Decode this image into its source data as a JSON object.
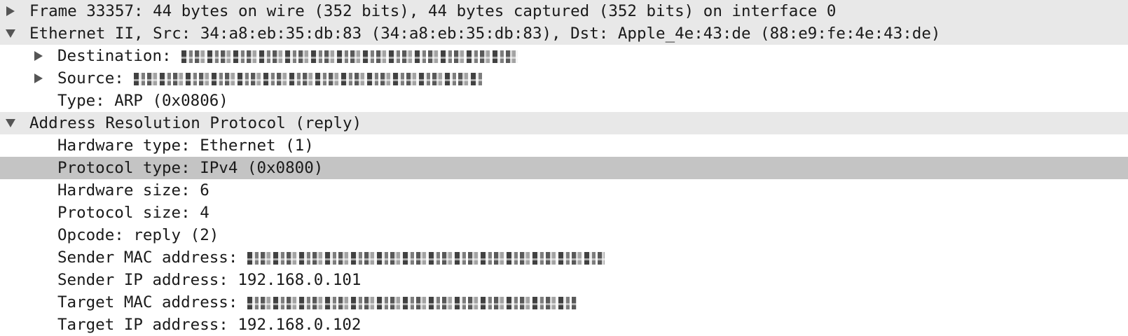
{
  "tree": {
    "frame": {
      "label": "Frame 33357: 44 bytes on wire (352 bits), 44 bytes captured (352 bits) on interface 0",
      "expanded": false
    },
    "ethernet": {
      "label": "Ethernet II, Src: 34:a8:eb:35:db:83 (34:a8:eb:35:db:83), Dst: Apple_4e:43:de (88:e9:fe:4e:43:de)",
      "expanded": true,
      "destination_label": "Destination:",
      "source_label": "Source:",
      "type_label": "Type: ARP (0x0806)"
    },
    "arp": {
      "label": "Address Resolution Protocol (reply)",
      "expanded": true,
      "hardware_type": "Hardware type: Ethernet (1)",
      "protocol_type": "Protocol type: IPv4 (0x0800)",
      "hardware_size": "Hardware size: 6",
      "protocol_size": "Protocol size: 4",
      "opcode": "Opcode: reply (2)",
      "sender_mac_label": "Sender MAC address:",
      "sender_ip": "Sender IP address: 192.168.0.101",
      "target_mac_label": "Target MAC address:",
      "target_ip": "Target IP address: 192.168.0.102"
    }
  },
  "colors": {
    "header_bg": "#e8e8e8",
    "selected_bg": "#c4c4c4",
    "text": "#1a1a1a",
    "toggle": "#555555"
  },
  "icons": {
    "collapsed": "triangle-right-icon",
    "expanded": "triangle-down-icon"
  }
}
